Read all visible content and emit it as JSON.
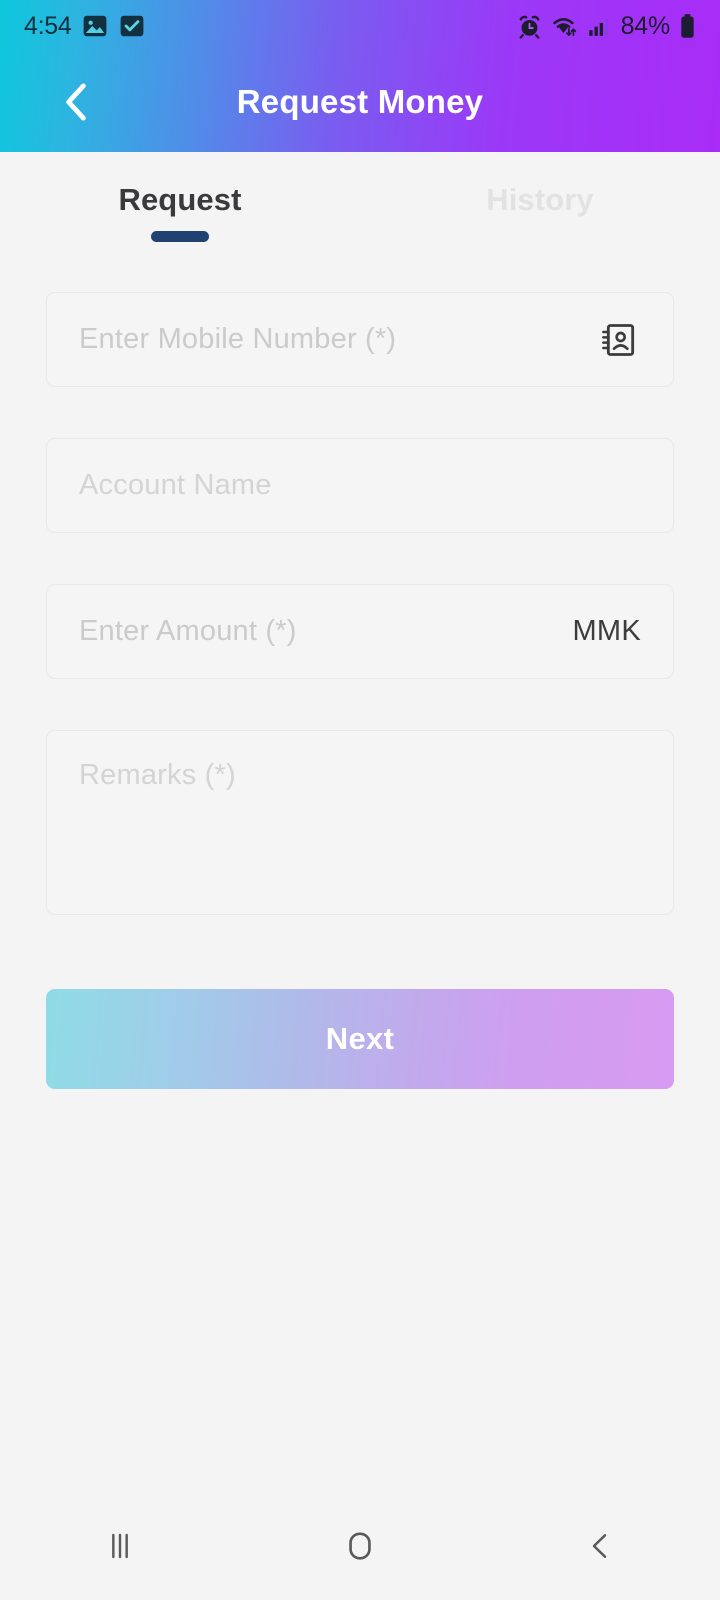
{
  "status_bar": {
    "time": "4:54",
    "battery_percent": "84%",
    "left_icons": [
      "image-icon",
      "checkbox-checked-icon"
    ],
    "right_icons": [
      "alarm-clock-icon",
      "wifi-icon",
      "cellular-signal-icon",
      "battery-icon"
    ]
  },
  "header": {
    "title": "Request Money",
    "back_icon": "chevron-left-icon",
    "gradient_start": "#0EC7DD",
    "gradient_end": "#A92CF7"
  },
  "tabs": [
    {
      "label": "Request",
      "active": true
    },
    {
      "label": "History",
      "active": false
    }
  ],
  "tab_indicator_color": "#1F4270",
  "form": {
    "mobile_number": {
      "placeholder": "Enter Mobile Number (*)",
      "value": "",
      "trailing_icon": "contact-book-icon"
    },
    "account_name": {
      "placeholder": "Account Name",
      "value": ""
    },
    "amount": {
      "placeholder": "Enter Amount (*)",
      "value": "",
      "currency": "MMK"
    },
    "remarks": {
      "placeholder": "Remarks (*)",
      "value": ""
    }
  },
  "primary_button": {
    "label": "Next",
    "gradient_start": "#8FDBE6",
    "gradient_end": "#D79BF2"
  },
  "nav_bar": {
    "recent_label": "recent-apps-icon",
    "home_label": "home-icon",
    "back_label": "back-icon"
  }
}
